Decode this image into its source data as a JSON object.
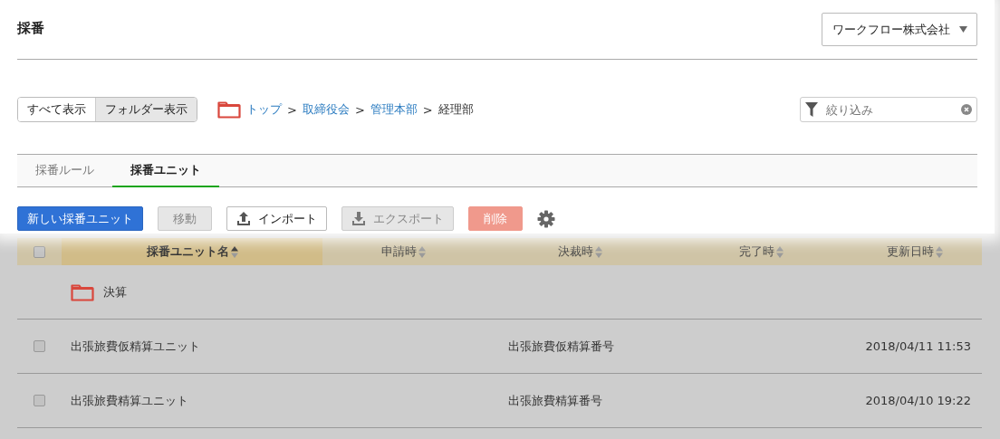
{
  "title": "採番",
  "company_select": {
    "value": "ワークフロー株式会社"
  },
  "view_toggle": [
    {
      "label": "すべて表示",
      "selected": false
    },
    {
      "label": "フォルダー表示",
      "selected": true
    }
  ],
  "breadcrumb": [
    {
      "label": "トップ",
      "link": true
    },
    {
      "separator": ">",
      "label": "取締役会",
      "link": true
    },
    {
      "separator": ">",
      "label": "管理本部",
      "link": true
    },
    {
      "separator": ">",
      "label": "経理部",
      "link": false
    }
  ],
  "filter": {
    "placeholder": "絞り込み"
  },
  "tabs": [
    {
      "label": "採番ルール",
      "selected": false
    },
    {
      "label": "採番ユニット",
      "selected": true
    }
  ],
  "toolbar": [
    {
      "label": "新しい採番ユニット",
      "kind": "primary",
      "disabled": false
    },
    {
      "label": "移動",
      "kind": "plain",
      "disabled": true
    },
    {
      "label": "インポート",
      "kind": "upload",
      "disabled": false
    },
    {
      "label": "エクスポート",
      "kind": "download",
      "disabled": true
    },
    {
      "label": "削除",
      "kind": "danger",
      "disabled": true
    }
  ],
  "table": {
    "select_all": {
      "checked": false
    },
    "columns": [
      {
        "label": "採番ユニット名",
        "sorted": true
      },
      {
        "label": "申請時",
        "sorted": false
      },
      {
        "label": "決裁時",
        "sorted": false
      },
      {
        "label": "完了時",
        "sorted": false
      },
      {
        "label": "更新日時",
        "sorted": false
      }
    ],
    "rows": [
      {
        "kind": "folder",
        "name": "決算"
      },
      {
        "kind": "unit",
        "checked": false,
        "name": "出張旅費仮精算ユニット",
        "decided": "出張旅費仮精算番号",
        "updated": "2018/04/11 11:53"
      },
      {
        "kind": "unit",
        "checked": false,
        "name": "出張旅費精算ユニット",
        "decided": "出張旅費精算番号",
        "updated": "2018/04/10 19:22"
      }
    ]
  }
}
